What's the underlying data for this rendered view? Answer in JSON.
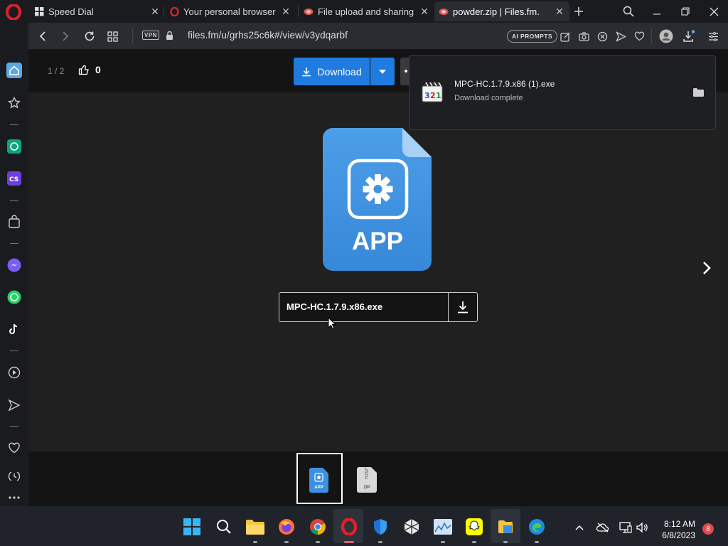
{
  "browser": {
    "tabs": [
      {
        "title": "Speed Dial",
        "favicon": "speed-dial-icon"
      },
      {
        "title": "Your personal browser is a",
        "favicon": "opera-icon"
      },
      {
        "title": "File upload and sharing. U",
        "favicon": "filesfm-icon"
      },
      {
        "title": "powder.zip | Files.fm.",
        "favicon": "filesfm-icon",
        "active": true
      }
    ],
    "url": "files.fm/u/grhs25c6k#/view/v3ydqarbf",
    "vpn_label": "VPN",
    "ai_prompts_label": "AI PROMPTS"
  },
  "viewer": {
    "counter": "1 / 2",
    "likes": "0",
    "download_label": "Download",
    "file_icon_label": "APP",
    "file_name": "MPC-HC.1.7.9.x86.exe",
    "thumb_app_label": "APP",
    "thumb_zip_label": "ZIP"
  },
  "download_popup": {
    "file_name": "MPC-HC.1.7.9.x86 (1).exe",
    "status": "Download complete"
  },
  "taskbar": {
    "time": "8:12 AM",
    "date": "6/8/2023",
    "notification_count": "8"
  },
  "colors": {
    "accent": "#1f7be0",
    "opera_red": "#e0202a",
    "file_blue": "#3b8fe0"
  }
}
